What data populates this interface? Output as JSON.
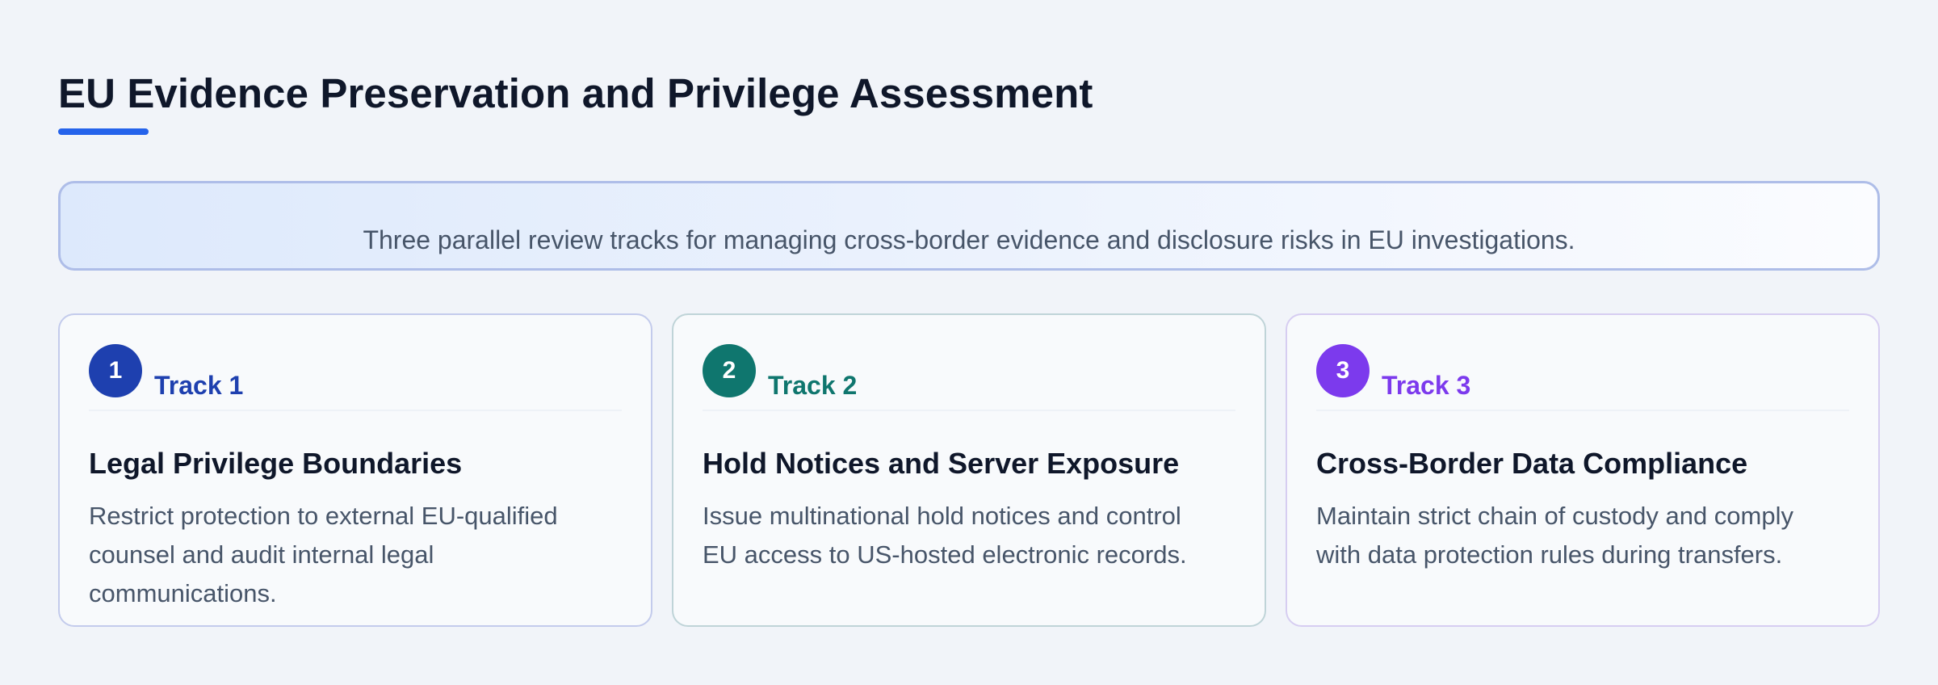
{
  "page": {
    "title": "EU Evidence Preservation and Privilege Assessment",
    "summary": "Three parallel review tracks for managing cross-border evidence and disclosure risks in EU investigations."
  },
  "colors": {
    "accent": "#2563eb",
    "track1": "#1e40af",
    "track2": "#0f766e",
    "track3": "#7c3aed"
  },
  "tracks": [
    {
      "number": "1",
      "label": "Track 1",
      "title": "Legal Privilege Boundaries",
      "description": "Restrict protection to external EU-qualified counsel and audit internal legal communications."
    },
    {
      "number": "2",
      "label": "Track 2",
      "title": "Hold Notices and Server Exposure",
      "description": "Issue multinational hold notices and control EU access to US-hosted electronic records."
    },
    {
      "number": "3",
      "label": "Track 3",
      "title": "Cross-Border Data Compliance",
      "description": "Maintain strict chain of custody and comply with data protection rules during transfers."
    }
  ]
}
